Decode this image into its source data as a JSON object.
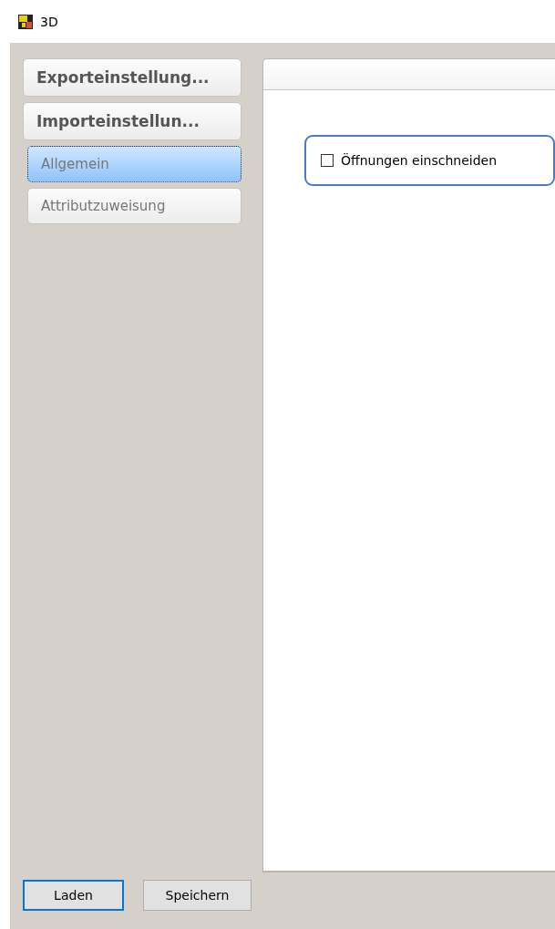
{
  "window": {
    "title": "3D"
  },
  "sidebar": {
    "items": [
      {
        "kind": "header",
        "label": "Exporteinstellung...",
        "selected": false
      },
      {
        "kind": "header",
        "label": "Importeinstellun...",
        "selected": false
      },
      {
        "kind": "item",
        "label": "Allgemein",
        "selected": true
      },
      {
        "kind": "item",
        "label": "Attributzuweisung",
        "selected": false
      }
    ]
  },
  "panel": {
    "checkbox": {
      "label": "Öffnungen einschneiden",
      "checked": false
    }
  },
  "buttons": [
    {
      "label": "Laden",
      "focused": true
    },
    {
      "label": "Speichern",
      "focused": false
    }
  ]
}
